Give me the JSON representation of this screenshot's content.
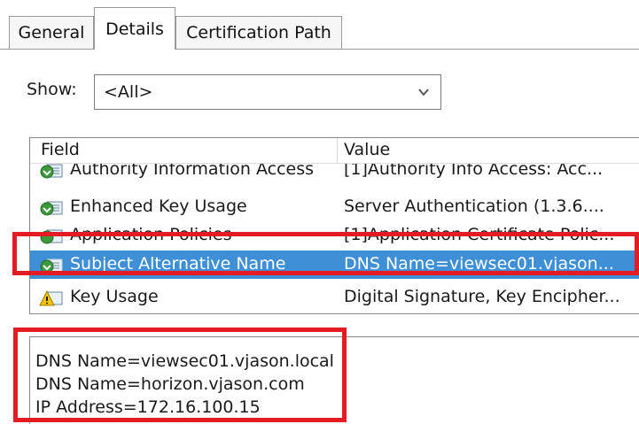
{
  "tabs": {
    "general": "General",
    "details": "Details",
    "certification_path": "Certification Path"
  },
  "show": {
    "label": "Show:",
    "selected": "<All>"
  },
  "list": {
    "columns": {
      "field": "Field",
      "value": "Value"
    },
    "rows": [
      {
        "field": "Authority Information Access",
        "value": "[1]Authority Info Access: Acc...",
        "icon": "cert-extension-icon"
      },
      {
        "field": "Enhanced Key Usage",
        "value": "Server Authentication (1.3.6....",
        "icon": "cert-extension-icon"
      },
      {
        "field": "Application Policies",
        "value": "[1]Application Certificate Polic...",
        "icon": "cert-extension-icon"
      },
      {
        "field": "Subject Alternative Name",
        "value": "DNS Name=viewsec01.vjason...",
        "icon": "cert-extension-icon",
        "selected": true
      },
      {
        "field": "Key Usage",
        "value": "Digital Signature, Key Encipher...",
        "icon": "warning-icon"
      }
    ]
  },
  "detail": {
    "lines": [
      "DNS Name=viewsec01.vjason.local",
      "DNS Name=horizon.vjason.com",
      "IP Address=172.16.100.15"
    ]
  },
  "colors": {
    "selection": "#3e8fd6",
    "highlight_box": "#e31b23"
  }
}
